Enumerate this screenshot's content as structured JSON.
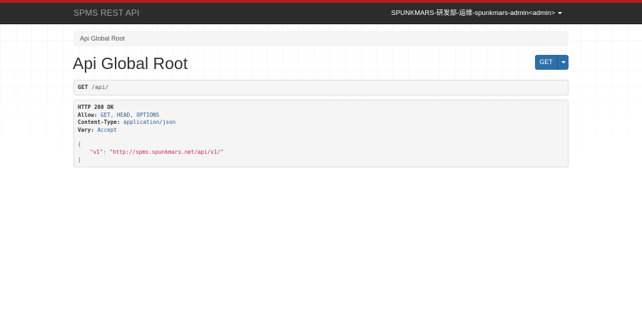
{
  "navbar": {
    "brand": "SPMS REST API",
    "user": "SPUNKMARS-研发部-运维-spunkmars-admin<admin>"
  },
  "breadcrumb": {
    "items": [
      "Api Global Root"
    ]
  },
  "page": {
    "title": "Api Global Root"
  },
  "toolbar": {
    "get_label": "GET"
  },
  "request": {
    "method": "GET",
    "path": "/api/"
  },
  "response": {
    "status": "HTTP 200 OK",
    "headers": [
      {
        "name": "Allow:",
        "value": "GET, HEAD, OPTIONS"
      },
      {
        "name": "Content-Type:",
        "value": "application/json"
      },
      {
        "name": "Vary:",
        "value": "Accept"
      }
    ],
    "body": {
      "open": "{",
      "key": "\"v1\"",
      "sep": ": ",
      "value": "\"http://spms.spunkmars.net/api/v1/\"",
      "close": "}"
    }
  },
  "colors": {
    "accent_top": "#b51b1b",
    "navbar_bg": "#2c2c2c",
    "button_primary": "#2f6fa8",
    "header_value": "#2a5d8f",
    "json_string": "#c7254e"
  }
}
